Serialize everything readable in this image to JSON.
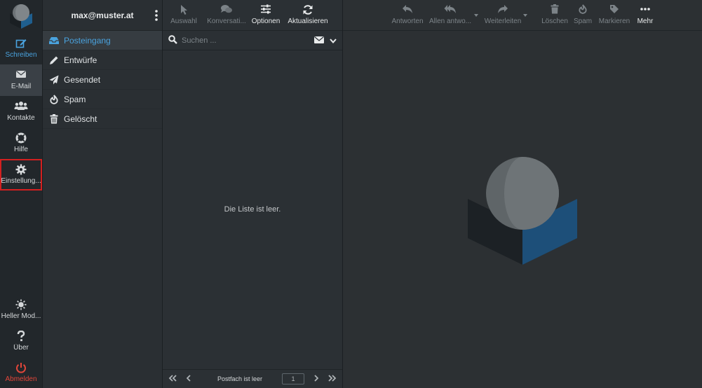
{
  "nav": {
    "compose": "Schreiben",
    "mail": "E-Mail",
    "contacts": "Kontakte",
    "help": "Hilfe",
    "settings": "Einstellung...",
    "light_mode": "Heller Mod...",
    "about": "Über",
    "logout": "Abmelden"
  },
  "account": {
    "email": "max@muster.at"
  },
  "folders": [
    {
      "label": "Posteingang",
      "icon": "inbox-icon"
    },
    {
      "label": "Entwürfe",
      "icon": "pencil-icon"
    },
    {
      "label": "Gesendet",
      "icon": "paper-plane-icon"
    },
    {
      "label": "Spam",
      "icon": "fire-icon"
    },
    {
      "label": "Gelöscht",
      "icon": "trash-icon"
    }
  ],
  "list_toolbar": {
    "select": "Auswahl",
    "threads": "Konversati...",
    "options": "Optionen",
    "refresh": "Aktualisieren"
  },
  "search": {
    "placeholder": "Suchen ..."
  },
  "list": {
    "empty": "Die Liste ist leer."
  },
  "pager": {
    "status": "Postfach ist leer",
    "page": "1"
  },
  "view_toolbar": {
    "reply": "Antworten",
    "reply_all": "Allen antwo...",
    "forward": "Weiterleiten",
    "delete": "Löschen",
    "spam": "Spam",
    "mark": "Markieren",
    "more": "Mehr"
  },
  "colors": {
    "accent": "#4aa3df",
    "danger": "#e2463a",
    "highlight_outline": "#d32020"
  }
}
